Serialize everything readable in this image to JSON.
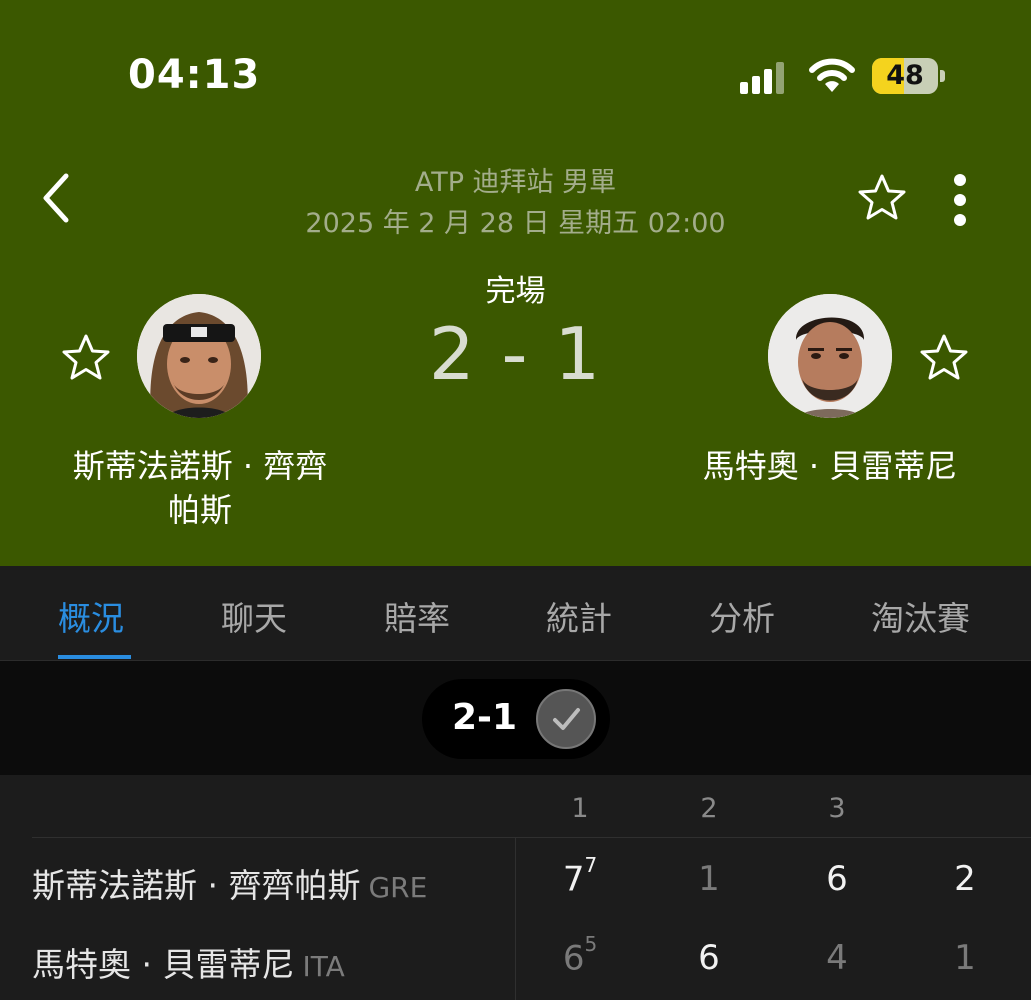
{
  "status_bar": {
    "time": "04:13",
    "battery": "48"
  },
  "match": {
    "competition": "ATP 迪拜站 男單",
    "datetime": "2025 年 2 月 28 日 星期五 02:00",
    "status": "完場",
    "score": "2 - 1",
    "home": {
      "name_line1": "斯蒂法諾斯 · 齊齊",
      "name_line2": "帕斯"
    },
    "away": {
      "name": "馬特奧 · 貝雷蒂尼"
    }
  },
  "tabs": [
    "概況",
    "聊天",
    "賠率",
    "統計",
    "分析",
    "淘汰賽"
  ],
  "active_tab": "概況",
  "summary": {
    "score": "2-1"
  },
  "scoreboard": {
    "set_headers": [
      "1",
      "2",
      "3"
    ],
    "rows": [
      {
        "name": "斯蒂法諾斯 · 齊齊帕斯",
        "country": "GRE",
        "s1": "7",
        "s1_tb": "7",
        "s2": "1",
        "s3": "6",
        "total": "2"
      },
      {
        "name": "馬特奧 · 貝雷蒂尼",
        "country": "ITA",
        "s1": "6",
        "s1_tb": "5",
        "s2": "6",
        "s3": "4",
        "total": "1"
      }
    ]
  },
  "colors": {
    "header_bg": "#3b5800",
    "accent": "#2a8de0",
    "battery": "#f4d31e"
  }
}
